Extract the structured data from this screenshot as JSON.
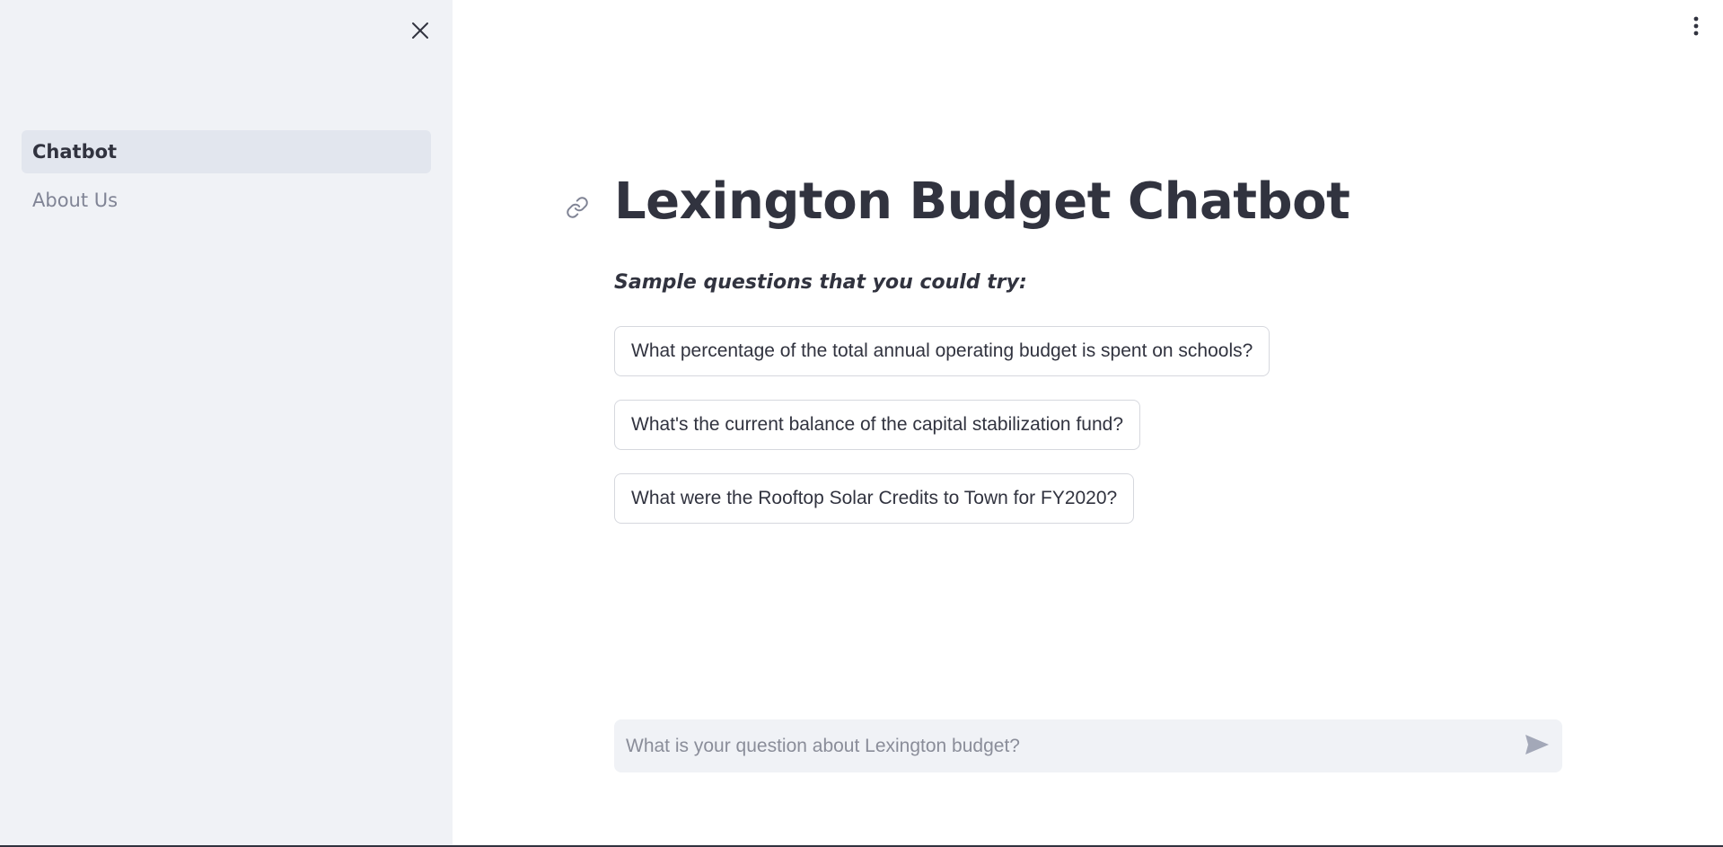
{
  "sidebar": {
    "close_icon": "close-icon",
    "items": [
      {
        "label": "Chatbot",
        "active": true
      },
      {
        "label": "About Us",
        "active": false
      }
    ]
  },
  "main": {
    "title": "Lexington Budget Chatbot",
    "link_icon": "link-icon",
    "subtitle": "Sample questions that you could try:",
    "sample_questions": [
      "What percentage of the total annual operating budget is spent on schools?",
      "What's the current balance of the capital stabilization fund?",
      "What were the Rooftop Solar Credits to Town for FY2020?"
    ],
    "chat_input": {
      "placeholder": "What is your question about Lexington budget?",
      "value": ""
    },
    "send_icon": "send-icon",
    "menu_icon": "more-vertical-icon"
  },
  "colors": {
    "sidebar_bg": "#f0f2f6",
    "nav_active_bg": "#e2e6ee",
    "text": "#31333f",
    "muted_text": "#808495",
    "border": "#d6d8de"
  }
}
